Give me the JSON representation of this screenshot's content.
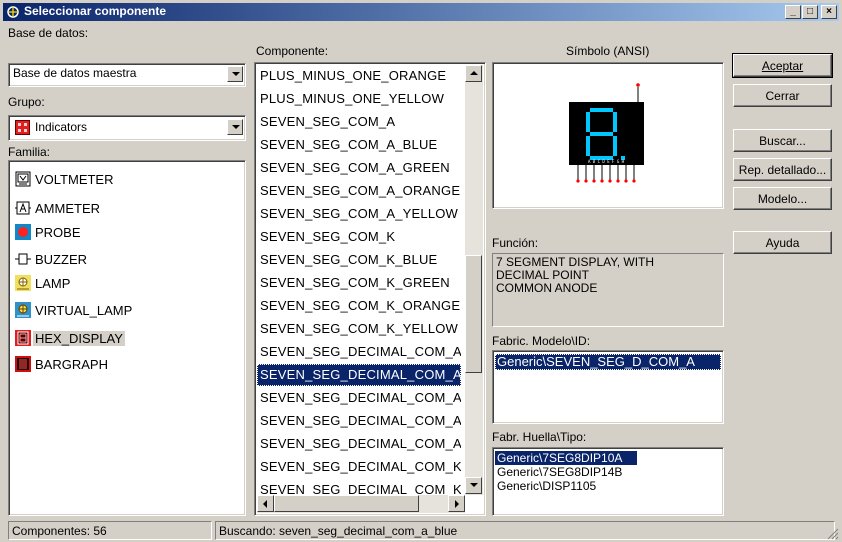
{
  "window": {
    "title": "Seleccionar componente"
  },
  "labels": {
    "database": "Base de datos:",
    "group": "Grupo:",
    "family": "Familia:",
    "component": "Componente:",
    "symbol": "Símbolo (ANSI)",
    "function": "Función:",
    "model": "Fabric. Modelo\\ID:",
    "footprint": "Fabr. Huella\\Tipo:"
  },
  "database": {
    "selected": "Base de datos maestra"
  },
  "group": {
    "selected": "Indicators",
    "icon": "indicator-icon"
  },
  "families": [
    {
      "label": "VOLTMETER",
      "icon": "voltmeter-icon"
    },
    {
      "label": "AMMETER",
      "icon": "ammeter-icon"
    },
    {
      "label": "PROBE",
      "icon": "probe-icon"
    },
    {
      "label": "BUZZER",
      "icon": "buzzer-icon"
    },
    {
      "label": "LAMP",
      "icon": "lamp-icon"
    },
    {
      "label": "VIRTUAL_LAMP",
      "icon": "virtual-lamp-icon"
    },
    {
      "label": "HEX_DISPLAY",
      "icon": "hex-display-icon"
    },
    {
      "label": "BARGRAPH",
      "icon": "bargraph-icon"
    }
  ],
  "components": [
    "PLUS_MINUS_ONE_ORANGE",
    "PLUS_MINUS_ONE_YELLOW",
    "SEVEN_SEG_COM_A",
    "SEVEN_SEG_COM_A_BLUE",
    "SEVEN_SEG_COM_A_GREEN",
    "SEVEN_SEG_COM_A_ORANGE",
    "SEVEN_SEG_COM_A_YELLOW",
    "SEVEN_SEG_COM_K",
    "SEVEN_SEG_COM_K_BLUE",
    "SEVEN_SEG_COM_K_GREEN",
    "SEVEN_SEG_COM_K_ORANGE",
    "SEVEN_SEG_COM_K_YELLOW",
    "SEVEN_SEG_DECIMAL_COM_A",
    "SEVEN_SEG_DECIMAL_COM_A_BLUE",
    "SEVEN_SEG_DECIMAL_COM_A_GREEN",
    "SEVEN_SEG_DECIMAL_COM_A_ORANGE",
    "SEVEN_SEG_DECIMAL_COM_A_YELLOW",
    "SEVEN_SEG_DECIMAL_COM_K",
    "SEVEN_SEG_DECIMAL_COM_K_BLUE"
  ],
  "selected_component_index": 13,
  "function_text": [
    "7 SEGMENT DISPLAY, WITH",
    "DECIMAL POINT",
    "COMMON ANODE"
  ],
  "model_ids": [
    "Generic\\SEVEN_SEG_D_COM_A"
  ],
  "footprints": [
    "Generic\\7SEG8DIP10A",
    "Generic\\7SEG8DIP14B",
    "Generic\\DISP1105"
  ],
  "buttons": {
    "accept": "Aceptar",
    "close": "Cerrar",
    "search": "Buscar...",
    "report": "Rep. detallado...",
    "model": "Modelo...",
    "help": "Ayuda"
  },
  "status": {
    "count": "Componentes: 56",
    "search": "Buscando: seven_seg_decimal_com_a_blue"
  },
  "symbol": {
    "segment_labels": "A B C D E F G H",
    "display_color": "#000000",
    "segment_color": "#00c8ff",
    "pin_color": "#ff0000"
  },
  "colors": {
    "selection": "#0a246a",
    "face": "#d4d0c8"
  }
}
